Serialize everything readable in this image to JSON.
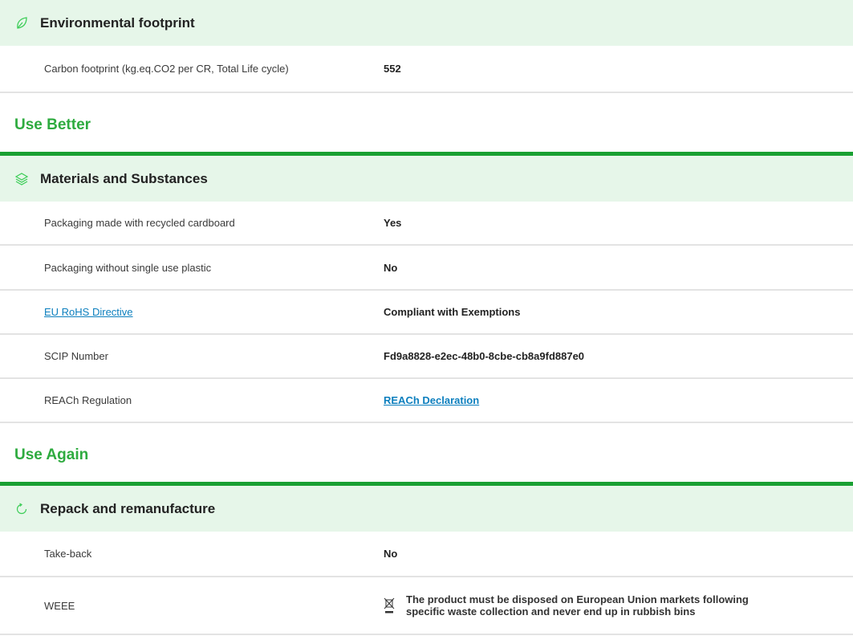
{
  "environmental_footprint": {
    "title": "Environmental footprint",
    "icon": "leaf-icon",
    "rows": [
      {
        "label": "Carbon footprint (kg.eq.CO2 per CR, Total Life cycle)",
        "value": "552"
      }
    ]
  },
  "use_better": {
    "title": "Use Better",
    "section": {
      "title": "Materials and Substances",
      "icon": "layers-icon",
      "rows": [
        {
          "label": "Packaging made with recycled cardboard",
          "value": "Yes"
        },
        {
          "label": "Packaging without single use plastic",
          "value": "No"
        },
        {
          "label": "EU RoHS Directive",
          "value": "Compliant with Exemptions"
        },
        {
          "label": "SCIP Number",
          "value": "Fd9a8828-e2ec-48b0-8cbe-cb8a9fd887e0"
        },
        {
          "label": "REACh Regulation",
          "value": "REACh Declaration"
        }
      ]
    }
  },
  "use_again": {
    "title": "Use Again",
    "section": {
      "title": "Repack and remanufacture",
      "icon": "refresh-icon",
      "rows": [
        {
          "label": "Take-back",
          "value": "No"
        },
        {
          "label": "WEEE",
          "value": "The product must be disposed on European Union markets following specific waste collection and never end up in rubbish bins",
          "icon": "crossed-bin-icon"
        }
      ]
    }
  },
  "colors": {
    "accent_green": "#19a032",
    "group_title_green": "#2eab3f",
    "section_bg": "#e6f6e9",
    "link_blue": "#0c7fbe"
  }
}
